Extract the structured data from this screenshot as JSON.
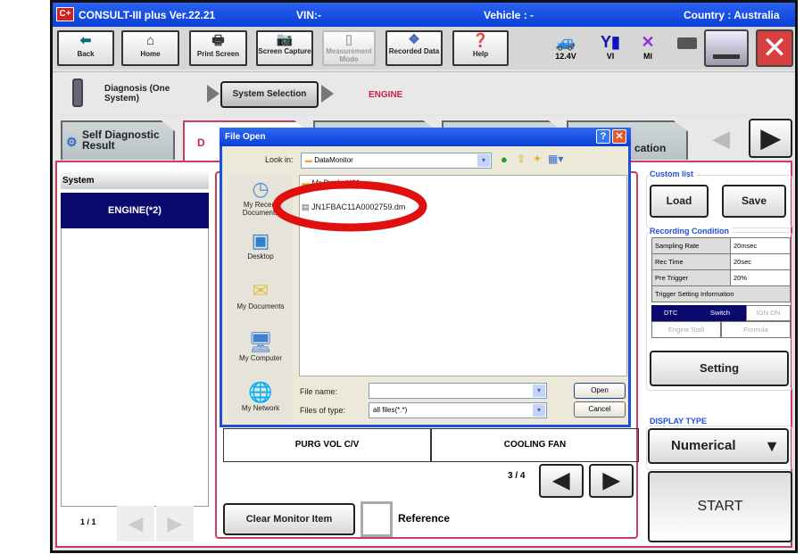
{
  "titlebar": {
    "app": "CONSULT-III plus  Ver.22.21",
    "vin": "VIN:-",
    "vehicle": "Vehicle : -",
    "country": "Country : Australia",
    "logo": "C+"
  },
  "toolbar": {
    "back": "Back",
    "home": "Home",
    "print": "Print Screen",
    "capture": "Screen Capture",
    "measure": "Measurement Mode",
    "recorded": "Recorded Data",
    "help": "Help",
    "voltage": "12.4V",
    "vi": "VI",
    "mi": "MI"
  },
  "breadcrumb": {
    "step1": "Diagnosis (One System)",
    "step2": "System Selection",
    "step3": "ENGINE"
  },
  "tabs": {
    "self_diag": "Self Diagnostic Result",
    "data_monitor": "D",
    "last": "cation"
  },
  "left": {
    "header": "System",
    "item": "ENGINE(*2)",
    "pager": "1 / 1"
  },
  "monitor": {
    "cells": [
      "PURG VOL C/V",
      "COOLING FAN"
    ],
    "pager": "3 / 4",
    "clear": "Clear Monitor Item",
    "reference": "Reference"
  },
  "right": {
    "custom_list": "Custom list",
    "load": "Load",
    "save": "Save",
    "recording": "Recording Condition",
    "rows": [
      [
        "Sampling Rate",
        "20msec"
      ],
      [
        "Rec Time",
        "20sec"
      ],
      [
        "Pre Trigger",
        "20%"
      ]
    ],
    "trigger_info": "Trigger Setting Information",
    "dtc": "DTC",
    "switch": "Switch",
    "ign_on": "IGN ON",
    "engine_stall": "Engine Stall",
    "formula": "Formula",
    "setting": "Setting",
    "display_type": "DISPLAY TYPE",
    "display_value": "Numerical",
    "start": "START"
  },
  "dialog": {
    "title": "File Open",
    "look_in_label": "Look in:",
    "look_in": "DataMonitor",
    "places": [
      "My Recent Documents",
      "Desktop",
      "My Documents",
      "My Computer",
      "My Network"
    ],
    "files": [
      "Mr Doyle Y61",
      "JN1FBAC11A0002759.dm"
    ],
    "file_name_label": "File name:",
    "file_name": "",
    "file_type_label": "Files of type:",
    "file_type": "all files(*.*)",
    "open": "Open",
    "cancel": "Cancel"
  },
  "colors": {
    "title_blue": "#0a3fd6",
    "accent_pink": "#c83c5c",
    "selected_navy": "#0a0a6e",
    "highlight_red": "#e01010"
  }
}
